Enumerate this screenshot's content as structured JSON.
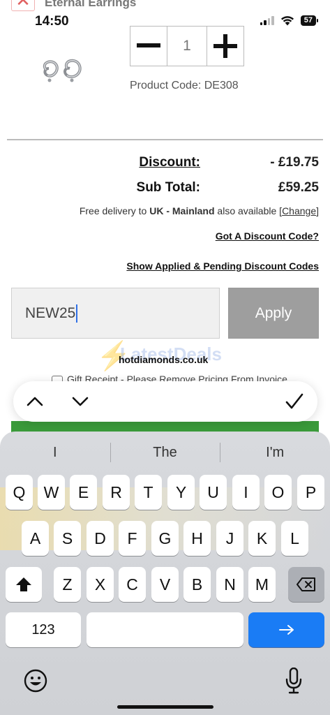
{
  "status_bar": {
    "time": "14:50",
    "battery": "57"
  },
  "product": {
    "name": "Eternal Earrings",
    "remove_icon": "close-icon",
    "quantity": "1",
    "code": "Product Code: DE308"
  },
  "totals": {
    "discount_label": "Discount:",
    "discount_value": "- £19.75",
    "subtotal_label": "Sub Total:",
    "subtotal_value": "£59.25"
  },
  "delivery": {
    "prefix": "Free delivery to ",
    "region": "UK - Mainland",
    "middle": " also available [",
    "change_link": "Change",
    "suffix": "]"
  },
  "links": {
    "discount_code": "Got A Discount Code?",
    "pending_codes": "Show Applied & Pending Discount Codes"
  },
  "discount_form": {
    "input_value": "NEW25",
    "apply_label": "Apply"
  },
  "watermark": {
    "text": "LatestDeals",
    "site": "hotdiamonds.co.uk"
  },
  "gift": {
    "label": "Gift Receipt - Please Remove Pricing From Invoice"
  },
  "keyboard": {
    "suggestions": [
      "I",
      "The",
      "I'm"
    ],
    "row1": [
      "Q",
      "W",
      "E",
      "R",
      "T",
      "Y",
      "U",
      "I",
      "O",
      "P"
    ],
    "row2": [
      "A",
      "S",
      "D",
      "F",
      "G",
      "H",
      "J",
      "K",
      "L"
    ],
    "row3": [
      "Z",
      "X",
      "C",
      "V",
      "B",
      "N",
      "M"
    ],
    "numbers_label": "123",
    "colors": {
      "go": "#1a7cf5",
      "key": "#ffffff",
      "keyboard_bg": "#d4d6da"
    }
  },
  "colors": {
    "apply_button": "#9e9e9e",
    "checkout_bar": "#3a9a3a",
    "caret": "#2f6fe6"
  }
}
